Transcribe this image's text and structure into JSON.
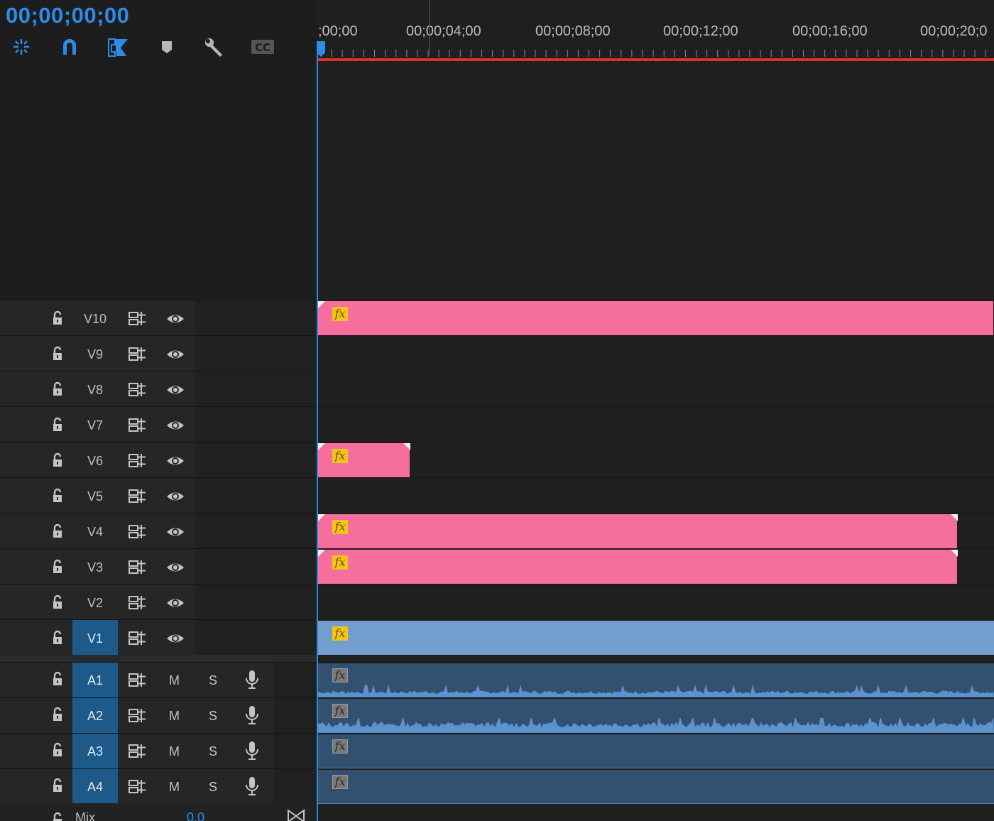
{
  "timecode": "00;00;00;00",
  "toolbar": {
    "tools": [
      "snap-nest-icon",
      "magnet-icon",
      "linked-selection-icon",
      "marker-icon",
      "wrench-icon",
      "captions-icon"
    ]
  },
  "ruler": {
    "labels": [
      ";00;00",
      "00;00;04;00",
      "00;00;08;00",
      "00;00;12;00",
      "00;00;16;00",
      "00;00;20;0"
    ]
  },
  "video_tracks": [
    {
      "name": "V10",
      "targeted": false
    },
    {
      "name": "V9",
      "targeted": false
    },
    {
      "name": "V8",
      "targeted": false
    },
    {
      "name": "V7",
      "targeted": false
    },
    {
      "name": "V6",
      "targeted": false
    },
    {
      "name": "V5",
      "targeted": false
    },
    {
      "name": "V4",
      "targeted": false
    },
    {
      "name": "V3",
      "targeted": false
    },
    {
      "name": "V2",
      "targeted": false
    },
    {
      "name": "V1",
      "targeted": true
    }
  ],
  "audio_tracks": [
    {
      "name": "A1",
      "mute": "M",
      "solo": "S"
    },
    {
      "name": "A2",
      "mute": "M",
      "solo": "S"
    },
    {
      "name": "A3",
      "mute": "M",
      "solo": "S"
    },
    {
      "name": "A4",
      "mute": "M",
      "solo": "S"
    }
  ],
  "mix": {
    "label": "Mix",
    "value": "0.0"
  },
  "fx_label": "fx",
  "colors": {
    "accent": "#2d8ceb",
    "clip_pink": "#f56e9e",
    "clip_blue": "#739dcc",
    "clip_audio": "#325070",
    "playhead_bar": "#e0302b"
  }
}
